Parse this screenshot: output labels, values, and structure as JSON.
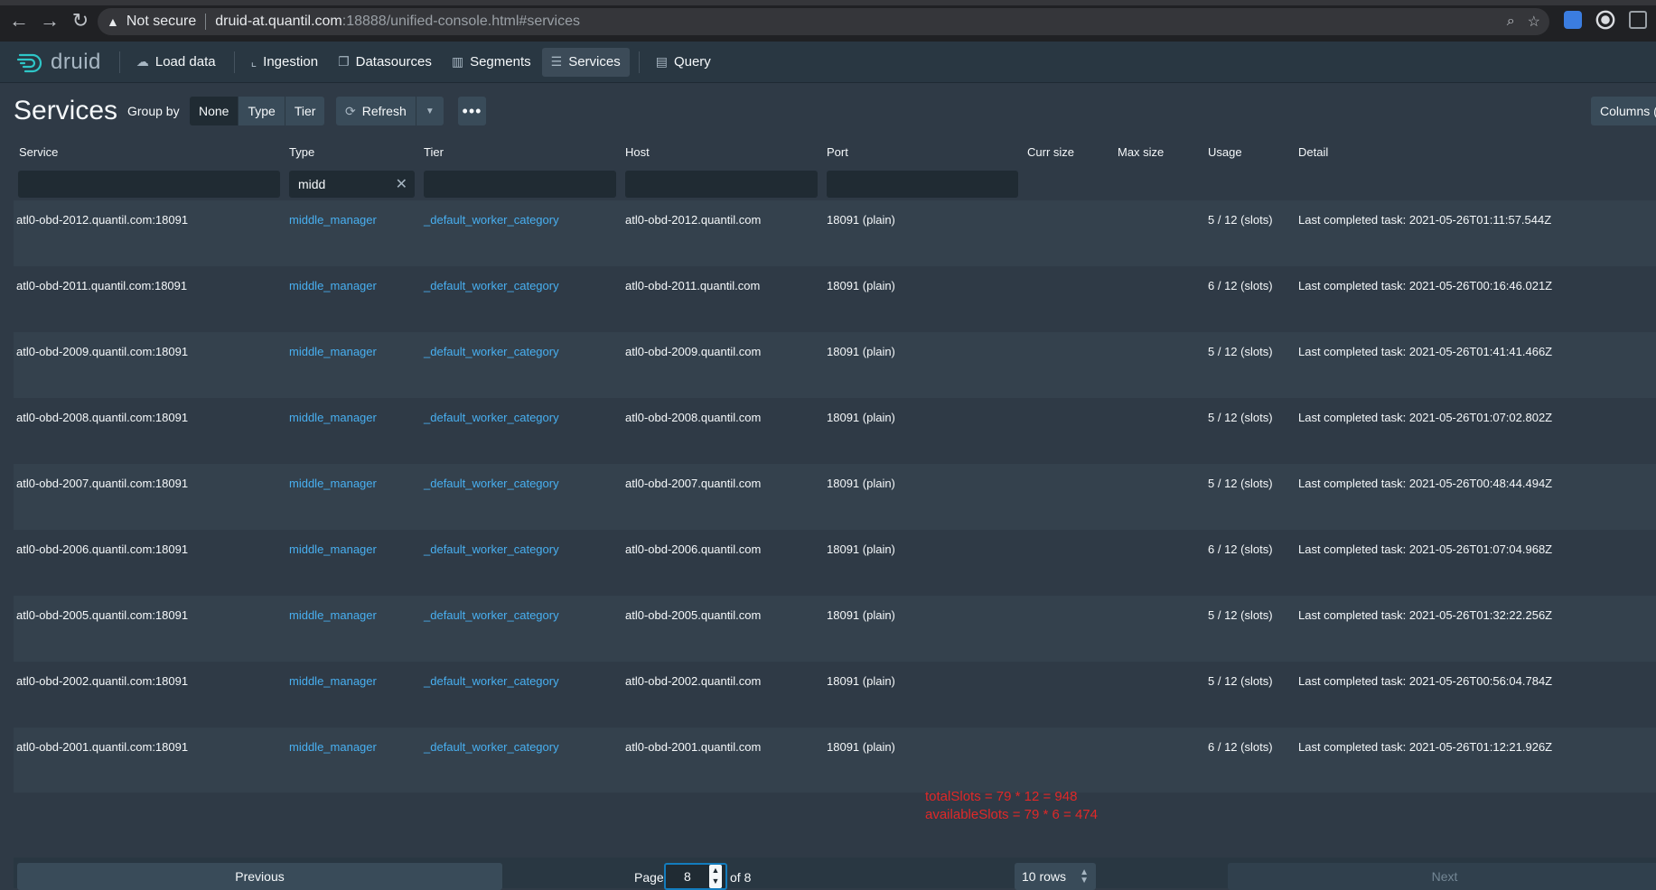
{
  "browser": {
    "security": "Not secure",
    "url_host": "druid-at.quantil.com",
    "url_path": ":18888/unified-console.html#services"
  },
  "header": {
    "logo": "druid",
    "nav": [
      {
        "label": "Load data",
        "icon": "cloud-upload-icon"
      },
      {
        "label": "Ingestion",
        "icon": "chart-line-icon"
      },
      {
        "label": "Datasources",
        "icon": "multi-window-icon"
      },
      {
        "label": "Segments",
        "icon": "stacked-bars-icon"
      },
      {
        "label": "Services",
        "icon": "database-icon",
        "active": true
      },
      {
        "label": "Query",
        "icon": "console-icon"
      }
    ]
  },
  "view": {
    "title": "Services",
    "group_by_label": "Group by",
    "group_by_options": [
      "None",
      "Type",
      "Tier"
    ],
    "group_by_selected": "None",
    "refresh_label": "Refresh",
    "columns_label": "Columns ("
  },
  "table": {
    "columns": [
      "Service",
      "Type",
      "Tier",
      "Host",
      "Port",
      "Curr size",
      "Max size",
      "Usage",
      "Detail"
    ],
    "filters": {
      "type": "midd"
    },
    "rows": [
      {
        "service": "atl0-obd-2012.quantil.com:18091",
        "type": "middle_manager",
        "tier": "_default_worker_category",
        "host": "atl0-obd-2012.quantil.com",
        "port": "18091 (plain)",
        "usage": "5 / 12 (slots)",
        "detail": "Last completed task: 2021-05-26T01:11:57.544Z"
      },
      {
        "service": "atl0-obd-2011.quantil.com:18091",
        "type": "middle_manager",
        "tier": "_default_worker_category",
        "host": "atl0-obd-2011.quantil.com",
        "port": "18091 (plain)",
        "usage": "6 / 12 (slots)",
        "detail": "Last completed task: 2021-05-26T00:16:46.021Z"
      },
      {
        "service": "atl0-obd-2009.quantil.com:18091",
        "type": "middle_manager",
        "tier": "_default_worker_category",
        "host": "atl0-obd-2009.quantil.com",
        "port": "18091 (plain)",
        "usage": "5 / 12 (slots)",
        "detail": "Last completed task: 2021-05-26T01:41:41.466Z"
      },
      {
        "service": "atl0-obd-2008.quantil.com:18091",
        "type": "middle_manager",
        "tier": "_default_worker_category",
        "host": "atl0-obd-2008.quantil.com",
        "port": "18091 (plain)",
        "usage": "5 / 12 (slots)",
        "detail": "Last completed task: 2021-05-26T01:07:02.802Z"
      },
      {
        "service": "atl0-obd-2007.quantil.com:18091",
        "type": "middle_manager",
        "tier": "_default_worker_category",
        "host": "atl0-obd-2007.quantil.com",
        "port": "18091 (plain)",
        "usage": "5 / 12 (slots)",
        "detail": "Last completed task: 2021-05-26T00:48:44.494Z"
      },
      {
        "service": "atl0-obd-2006.quantil.com:18091",
        "type": "middle_manager",
        "tier": "_default_worker_category",
        "host": "atl0-obd-2006.quantil.com",
        "port": "18091 (plain)",
        "usage": "6 / 12 (slots)",
        "detail": "Last completed task: 2021-05-26T01:07:04.968Z"
      },
      {
        "service": "atl0-obd-2005.quantil.com:18091",
        "type": "middle_manager",
        "tier": "_default_worker_category",
        "host": "atl0-obd-2005.quantil.com",
        "port": "18091 (plain)",
        "usage": "5 / 12 (slots)",
        "detail": "Last completed task: 2021-05-26T01:32:22.256Z"
      },
      {
        "service": "atl0-obd-2002.quantil.com:18091",
        "type": "middle_manager",
        "tier": "_default_worker_category",
        "host": "atl0-obd-2002.quantil.com",
        "port": "18091 (plain)",
        "usage": "5 / 12 (slots)",
        "detail": "Last completed task: 2021-05-26T00:56:04.784Z"
      },
      {
        "service": "atl0-obd-2001.quantil.com:18091",
        "type": "middle_manager",
        "tier": "_default_worker_category",
        "host": "atl0-obd-2001.quantil.com",
        "port": "18091 (plain)",
        "usage": "6 / 12 (slots)",
        "detail": "Last completed task: 2021-05-26T01:12:21.926Z"
      }
    ]
  },
  "annotation": {
    "line1": "totalSlots = 79 * 12 = 948",
    "line2": "availableSlots = 79 * 6 = 474",
    "color": "#e02828"
  },
  "pagination": {
    "previous_label": "Previous",
    "page_label": "Page",
    "page_value": "8",
    "of_label": "of 8",
    "rows_label": "10 rows",
    "next_label": "Next"
  }
}
